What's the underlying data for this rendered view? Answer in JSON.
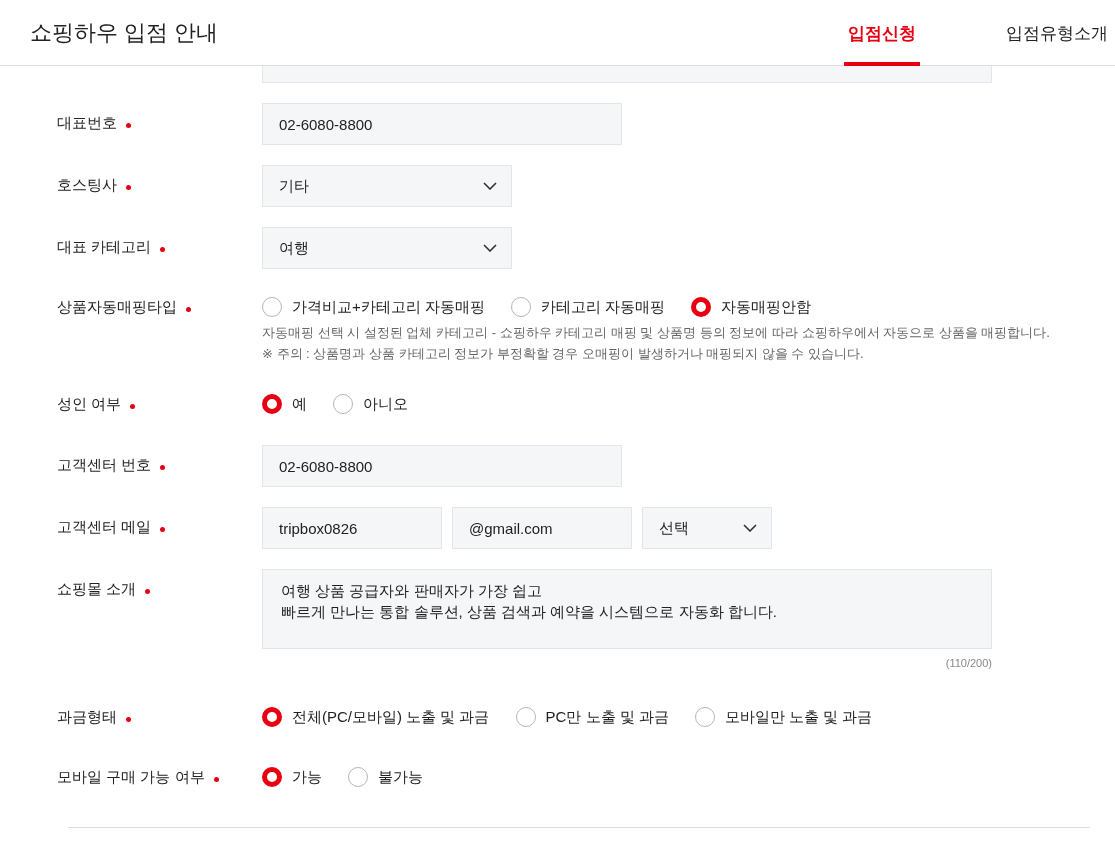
{
  "header": {
    "title": "쇼핑하우 입점 안내",
    "tabs": [
      {
        "label": "입점신청",
        "selected": true
      },
      {
        "label": "입점유형소개",
        "selected": false
      }
    ]
  },
  "rows": [
    {
      "kind": "partial"
    },
    {
      "kind": "text",
      "label": "대표번호",
      "required": true,
      "value": "02-6080-8800"
    },
    {
      "kind": "select",
      "label": "호스팅사",
      "required": true,
      "value": "기타"
    },
    {
      "kind": "select",
      "label": "대표 카테고리",
      "required": true,
      "value": "여행"
    },
    {
      "kind": "radio",
      "label": "상품자동매핑타입",
      "required": true,
      "options": [
        {
          "label": "가격비교+카테고리 자동매핑",
          "selected": false
        },
        {
          "label": "카테고리 자동매핑",
          "selected": false
        },
        {
          "label": "자동매핑안함",
          "selected": true
        }
      ],
      "hints": [
        "자동매핑 선택 시 설정된 업체 카테고리 - 쇼핑하우 카테고리 매핑 및 상품명 등의 정보에 따라 쇼핑하우에서 자동으로 상품을 매핑합니다.",
        "※ 주의 : 상품명과 상품 카테고리 정보가 부정확할 경우 오매핑이 발생하거나 매핑되지 않을 수 있습니다."
      ]
    },
    {
      "kind": "radio",
      "label": "성인 여부",
      "required": true,
      "options": [
        {
          "label": "예",
          "selected": true
        },
        {
          "label": "아니오",
          "selected": false
        }
      ]
    },
    {
      "kind": "text",
      "label": "고객센터 번호",
      "required": true,
      "value": "02-6080-8800"
    },
    {
      "kind": "email",
      "label": "고객센터 메일",
      "required": true,
      "user": "tripbox0826",
      "domain": "@gmail.com",
      "choice": "선택"
    },
    {
      "kind": "textarea",
      "label": "쇼핑몰 소개",
      "required": true,
      "lines": [
        "여행 상품 공급자와 판매자가 가장 쉽고",
        "빠르게 만나는 통합 솔루션, 상품 검색과 예약을 시스템으로 자동화 합니다."
      ],
      "counter": "(110/200)"
    },
    {
      "kind": "radio",
      "label": "과금형태",
      "required": true,
      "options": [
        {
          "label": "전체(PC/모바일) 노출 및 과금",
          "selected": true
        },
        {
          "label": "PC만 노출 및 과금",
          "selected": false
        },
        {
          "label": "모바일만 노출 및 과금",
          "selected": false
        }
      ]
    },
    {
      "kind": "radio",
      "label": "모바일 구매 가능 여부",
      "required": true,
      "options": [
        {
          "label": "가능",
          "selected": true
        },
        {
          "label": "불가능",
          "selected": false
        }
      ]
    }
  ]
}
